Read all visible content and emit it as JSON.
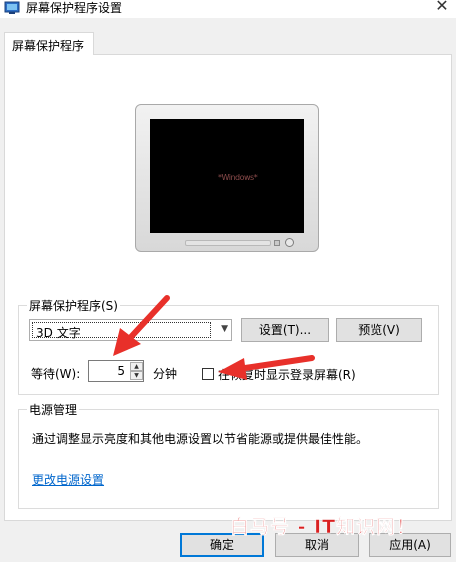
{
  "window": {
    "title": "屏幕保护程序设置",
    "close_glyph": "✕"
  },
  "tabs": [
    {
      "label": "屏幕保护程序"
    }
  ],
  "preview": {
    "screen_text": "*Windows*"
  },
  "screensaver_group": {
    "label": "屏幕保护程序(S)",
    "selected_saver": "3D 文字",
    "settings_button": "设置(T)...",
    "preview_button": "预览(V)",
    "wait_label": "等待(W):",
    "wait_value": "5",
    "wait_unit": "分钟",
    "resume_checkbox_label": "在恢复时显示登录屏幕(R)",
    "resume_checked": false
  },
  "power_group": {
    "label": "电源管理",
    "description": "通过调整显示亮度和其他电源设置以节省能源或提供最佳性能。",
    "link": "更改电源设置"
  },
  "footer": {
    "ok_button": "确定",
    "cancel_button": "取消",
    "apply_button": "应用(A)"
  },
  "watermark": "白马号 - IT知识网！",
  "colors": {
    "accent": "#0078d7",
    "link": "#0066cc",
    "annotation_arrow": "#e8302a",
    "watermark": "#d92020"
  }
}
